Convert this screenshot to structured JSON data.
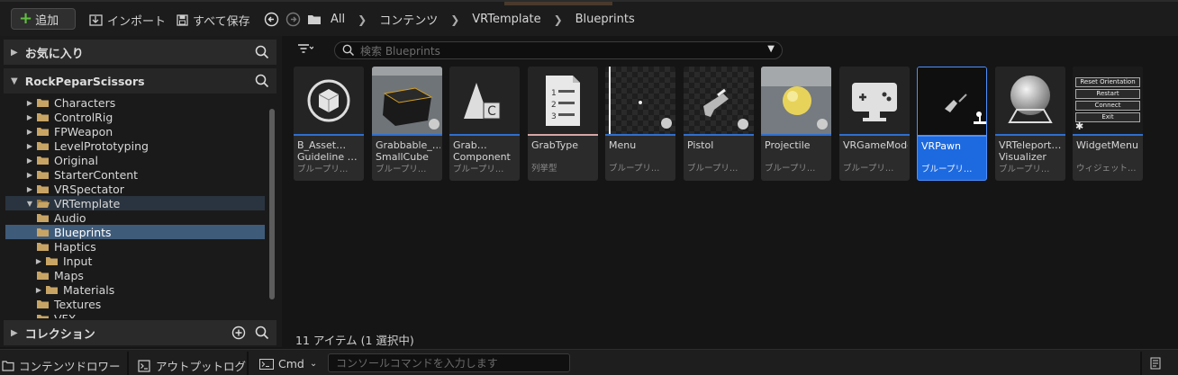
{
  "toolbar": {
    "add_label": "追加",
    "import_label": "インポート",
    "save_all_label": "すべて保存",
    "breadcrumbs": [
      "All",
      "コンテンツ",
      "VRTemplate",
      "Blueprints"
    ]
  },
  "left_panel": {
    "favorites_label": "お気に入り",
    "project_name": "RockPeparScissors",
    "collections_label": "コレクション",
    "tree": [
      {
        "label": "Characters",
        "expanded": false
      },
      {
        "label": "ControlRig",
        "expanded": false
      },
      {
        "label": "FPWeapon",
        "expanded": false
      },
      {
        "label": "LevelPrototyping",
        "expanded": false
      },
      {
        "label": "Original",
        "expanded": false
      },
      {
        "label": "StarterContent",
        "expanded": false
      },
      {
        "label": "VRSpectator",
        "expanded": false
      },
      {
        "label": "VRTemplate",
        "expanded": true
      },
      {
        "label": "Audio",
        "expanded": false
      },
      {
        "label": "Blueprints",
        "selected": true
      },
      {
        "label": "Haptics",
        "expanded": false
      },
      {
        "label": "Input",
        "expanded": false
      },
      {
        "label": "Maps",
        "expanded": false
      },
      {
        "label": "Materials",
        "expanded": false
      },
      {
        "label": "Textures",
        "expanded": false
      },
      {
        "label": "VFX",
        "expanded": false
      }
    ]
  },
  "search": {
    "placeholder": "検索 Blueprints"
  },
  "assets": [
    {
      "line1": "B_Asset…",
      "line2": "Guideline …",
      "type": "ブループリ…",
      "thumb": "cube-icon"
    },
    {
      "line1": "Grabbable_…",
      "line2": "SmallCube",
      "type": "ブループリ…",
      "thumb": "small-cube"
    },
    {
      "line1": "Grab…",
      "line2": "Component",
      "type": "ブループリ…",
      "thumb": "component-icon"
    },
    {
      "line1": "GrabType",
      "line2": "",
      "type": "列挙型",
      "thumb": "enum-icon"
    },
    {
      "line1": "Menu",
      "line2": "",
      "type": "ブループリ…",
      "thumb": "menu-preview"
    },
    {
      "line1": "Pistol",
      "line2": "",
      "type": "ブループリ…",
      "thumb": "pistol-preview"
    },
    {
      "line1": "Projectile",
      "line2": "",
      "type": "ブループリ…",
      "thumb": "projectile-sphere"
    },
    {
      "line1": "VRGameMode",
      "line2": "",
      "type": "ブループリ…",
      "thumb": "gamemode-icon"
    },
    {
      "line1": "VRPawn",
      "line2": "",
      "type": "ブループリ…",
      "thumb": "pawn-preview",
      "selected": true
    },
    {
      "line1": "VRTeleport…",
      "line2": "Visualizer",
      "type": "ブループリ…",
      "thumb": "sphere-preview"
    },
    {
      "line1": "WidgetMenu",
      "line2": "",
      "type": "ウィジェット…",
      "thumb": "widget-preview"
    }
  ],
  "widget_thumb_buttons": [
    "Reset Orientation",
    "Restart",
    "Connect",
    "Exit"
  ],
  "status": "11 アイテム (1 選択中)",
  "bottom_bar": {
    "content_drawer": "コンテンツドロワー",
    "output_log": "アウトプットログ",
    "cmd": "Cmd",
    "console_placeholder": "コンソールコマンドを入力します"
  },
  "colors": {
    "accent": "#1d6ae0",
    "folder": "#c8a464",
    "add_plus": "#60c040"
  }
}
